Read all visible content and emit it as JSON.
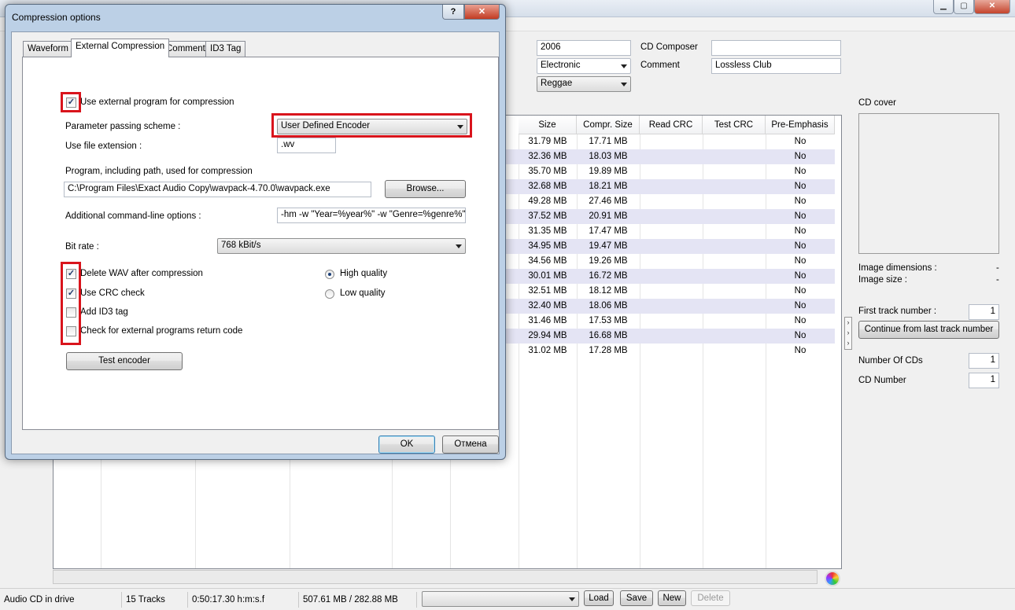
{
  "main_window": {
    "album": {
      "year": "2006",
      "genre": "Electronic",
      "style": "Reggae",
      "cd_composer_label": "CD Composer",
      "cd_composer_value": "",
      "comment_label": "Comment",
      "comment_value": "Lossless Club"
    },
    "track_table": {
      "columns": [
        "Size",
        "Compr. Size",
        "Read CRC",
        "Test CRC",
        "Pre-Emphasis"
      ],
      "rows": [
        {
          "size": "31.79 MB",
          "compr": "17.71 MB",
          "pre": "No"
        },
        {
          "size": "32.36 MB",
          "compr": "18.03 MB",
          "pre": "No"
        },
        {
          "size": "35.70 MB",
          "compr": "19.89 MB",
          "pre": "No"
        },
        {
          "size": "32.68 MB",
          "compr": "18.21 MB",
          "pre": "No"
        },
        {
          "size": "49.28 MB",
          "compr": "27.46 MB",
          "pre": "No"
        },
        {
          "size": "37.52 MB",
          "compr": "20.91 MB",
          "pre": "No"
        },
        {
          "size": "31.35 MB",
          "compr": "17.47 MB",
          "pre": "No"
        },
        {
          "size": "34.95 MB",
          "compr": "19.47 MB",
          "pre": "No"
        },
        {
          "size": "34.56 MB",
          "compr": "19.26 MB",
          "pre": "No"
        },
        {
          "size": "30.01 MB",
          "compr": "16.72 MB",
          "pre": "No"
        },
        {
          "size": "32.51 MB",
          "compr": "18.12 MB",
          "pre": "No"
        },
        {
          "size": "32.40 MB",
          "compr": "18.06 MB",
          "pre": "No"
        },
        {
          "size": "31.46 MB",
          "compr": "17.53 MB",
          "pre": "No"
        },
        {
          "size": "29.94 MB",
          "compr": "16.68 MB",
          "pre": "No"
        },
        {
          "size": "31.02 MB",
          "compr": "17.28 MB",
          "pre": "No"
        }
      ]
    },
    "right_panel": {
      "cd_cover_label": "CD cover",
      "image_dimensions_label": "Image dimensions :",
      "image_dimensions_value": "-",
      "image_size_label": "Image size :",
      "image_size_value": "-",
      "first_track_label": "First track number :",
      "first_track_value": "1",
      "continue_button": "Continue from last track number",
      "number_of_cds_label": "Number Of CDs",
      "number_of_cds_value": "1",
      "cd_number_label": "CD Number",
      "cd_number_value": "1"
    },
    "status_bar": {
      "drive": "Audio CD in drive",
      "tracks": "15 Tracks",
      "duration": "0:50:17.30 h:m:s.f",
      "sizes": "507.61 MB / 282.88 MB",
      "load": "Load",
      "save": "Save",
      "new": "New",
      "delete": "Delete"
    }
  },
  "dialog": {
    "title": "Compression options",
    "help_glyph": "?",
    "close_glyph": "✕",
    "tabs": [
      "Waveform",
      "External Compression",
      "Comment",
      "ID3 Tag"
    ],
    "use_external_label": "Use external program for compression",
    "use_external_checked": true,
    "param_scheme_label": "Parameter passing scheme :",
    "param_scheme_value": "User Defined Encoder",
    "file_ext_label": "Use file extension :",
    "file_ext_value": ".wv",
    "program_label": "Program, including path, used for compression",
    "program_path": "C:\\Program Files\\Exact Audio Copy\\wavpack-4.70.0\\wavpack.exe",
    "browse": "Browse...",
    "cmdline_label": "Additional command-line options :",
    "cmdline_value": "-hm -w \"Year=%year%\" -w \"Genre=%genre%\" %sc",
    "bitrate_label": "Bit rate :",
    "bitrate_value": "768 kBit/s",
    "options": [
      {
        "label": "Delete WAV after compression",
        "checked": true
      },
      {
        "label": "Use CRC check",
        "checked": true
      },
      {
        "label": "Add ID3 tag",
        "checked": false
      },
      {
        "label": "Check for external programs return code",
        "checked": false
      }
    ],
    "quality": [
      {
        "label": "High quality",
        "selected": true
      },
      {
        "label": "Low quality",
        "selected": false
      }
    ],
    "test_encoder": "Test encoder",
    "ok": "OK",
    "cancel": "Отмена",
    "highlight_color": "#d9141c"
  }
}
